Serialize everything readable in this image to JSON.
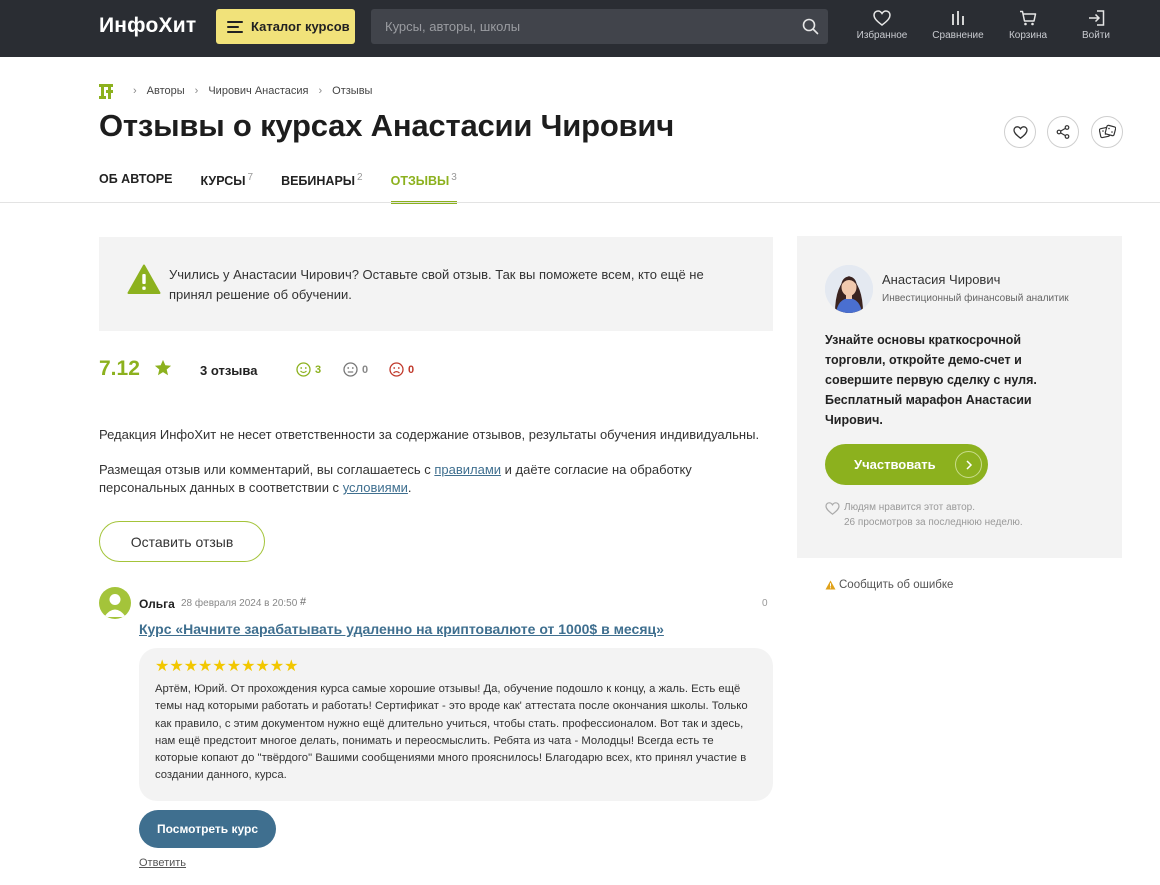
{
  "header": {
    "logo": "ИнфоХит",
    "catalog_label": "Каталог курсов",
    "search_placeholder": "Курсы, авторы, школы",
    "nav": [
      {
        "label": "Избранное",
        "icon": "heart-icon"
      },
      {
        "label": "Сравнение",
        "icon": "compare-icon"
      },
      {
        "label": "Корзина",
        "icon": "cart-icon"
      },
      {
        "label": "Войти",
        "icon": "login-icon"
      }
    ]
  },
  "breadcrumb": {
    "home_icon": "site-logo-icon",
    "items": [
      "Авторы",
      "Чирович Анастасия",
      "Отзывы"
    ]
  },
  "page": {
    "title": "Отзывы о курсах Анастасии Чирович"
  },
  "tabs": [
    {
      "label": "ОБ АВТОРЕ",
      "count": ""
    },
    {
      "label": "КУРСЫ",
      "count": "7"
    },
    {
      "label": "ВЕБИНАРЫ",
      "count": "2"
    },
    {
      "label": "ОТЗЫВЫ",
      "count": "3"
    }
  ],
  "notice": {
    "text": "Учились у Анастасии Чирович? Оставьте свой отзыв. Так вы поможете всем, кто ещё не принял решение об обучении."
  },
  "rating": {
    "value": "7.12",
    "reviews_count": "3 отзыва",
    "positive": "3",
    "neutral": "0",
    "negative": "0",
    "colors": {
      "accent": "#8cb11e",
      "negative": "#c0392b"
    }
  },
  "disclaimer": "Редакция ИнфоХит не несет ответственности за содержание отзывов, результаты обучения индивидуальны.",
  "agree": {
    "part1": "Размещая отзыв или комментарий, вы соглашаетесь с ",
    "rules_link": "правилами",
    "part2": " и даёте согласие на обработку персональных данных в соответствии с ",
    "terms_link": "условиями",
    "part3": "."
  },
  "leave_review_label": "Оставить отзыв",
  "review": {
    "author": "Ольга",
    "date": "28 февраля 2024 в 20:50",
    "hash": "#",
    "votes": "0",
    "course": "Курс «Начните зарабатывать удаленно на криптовалюте от 1000$ в месяц»",
    "stars": "★★★★★★★★★★",
    "rating": 10,
    "text": "Артём, Юрий. От прохождения курса самые хорошие отзывы! Да, обучение подошло к концу, а жаль. Есть ещё темы над которыми работать и работать! Сертификат - это вроде как' аттестата после окончания школы. Только как правило, с этим документом нужно ещё длительно учиться, чтобы стать. профессионалом. Вот так и здесь, нам ещё предстоит многое делать, понимать и переосмыслить. Ребята из чата - Молодцы! Всегда есть те которые копают до \"твёрдого\" Вашими сообщениями много прояснилось! Благодарю всех, кто принял участие в создании данного, курса.",
    "view_course_label": "Посмотреть курс",
    "reply_label": "Ответить"
  },
  "sidebar": {
    "name": "Анастасия Чирович",
    "role": "Инвестиционный финансовый аналитик",
    "promo": "Узнайте основы краткосрочной торговли, откройте демо-счет и совершите первую сделку с нуля. Бесплатный марафон Анастасии Чирович.",
    "join_label": "Участвовать",
    "likes_text": "Людям нравится этот автор.",
    "views_text": "26 просмотров за последнюю неделю.",
    "report_label": "Сообщить об ошибке"
  }
}
